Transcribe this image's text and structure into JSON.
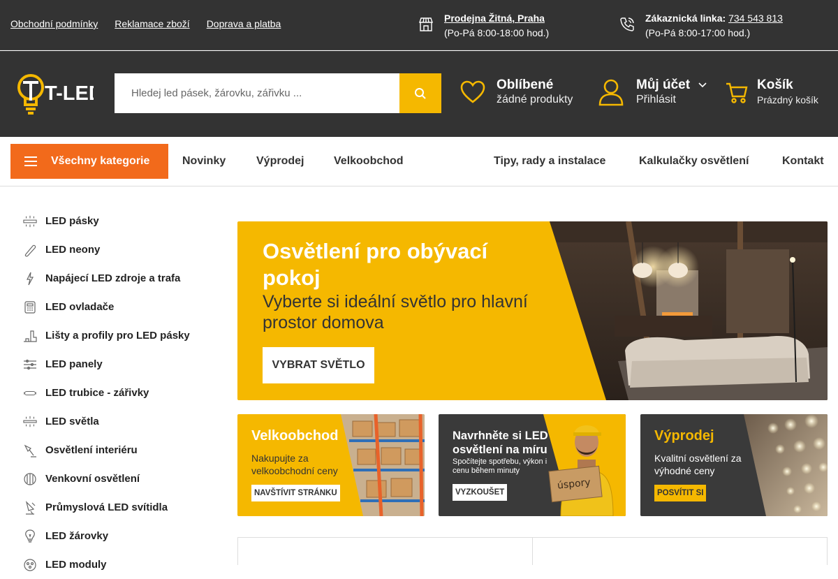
{
  "topbar": {
    "links": [
      "Obchodní podmínky",
      "Reklamace zboží",
      "Doprava a platba"
    ],
    "store_name": "Prodejna Žitná, Praha",
    "store_hours": "(Po-Pá 8:00-18:00 hod.)",
    "phone_label": "Zákaznická linka:",
    "phone_number": "734 543 813",
    "phone_hours": "(Po-Pá 8:00-17:00 hod.)"
  },
  "header": {
    "logo_text": "T-LED",
    "search_placeholder": "Hledej led pásek, žárovku, zářivku ...",
    "favorites_title": "Oblíbené",
    "favorites_sub": "žádné produkty",
    "account_title": "Můj účet",
    "account_sub": "Přihlásit",
    "cart_title": "Košík",
    "cart_sub": "Prázdný košík"
  },
  "nav": {
    "all_categories": "Všechny kategorie",
    "items": [
      "Novinky",
      "Výprodej",
      "Velkoobchod",
      "Tipy, rady a instalace",
      "Kalkulačky osvětlení",
      "Kontakt"
    ]
  },
  "sidebar": {
    "items": [
      {
        "label": "LED pásky",
        "icon": "led-strip-icon"
      },
      {
        "label": "LED neony",
        "icon": "neon-icon"
      },
      {
        "label": "Napájecí LED zdroje a trafa",
        "icon": "power-icon"
      },
      {
        "label": "LED ovladače",
        "icon": "remote-icon"
      },
      {
        "label": "Lišty a profily pro LED pásky",
        "icon": "profile-icon"
      },
      {
        "label": "LED panely",
        "icon": "panel-icon"
      },
      {
        "label": "LED trubice - zářivky",
        "icon": "tube-icon"
      },
      {
        "label": "LED světla",
        "icon": "ceiling-light-icon"
      },
      {
        "label": "Osvětlení interiéru",
        "icon": "lamp-icon"
      },
      {
        "label": "Venkovní osvětlení",
        "icon": "outdoor-icon"
      },
      {
        "label": "Průmyslová LED svítidla",
        "icon": "industrial-icon"
      },
      {
        "label": "LED žárovky",
        "icon": "bulb-icon"
      },
      {
        "label": "LED moduly",
        "icon": "module-icon"
      }
    ]
  },
  "hero": {
    "title": "Osvětlení pro obývací pokoj",
    "subtitle": "Vyberte si ideální světlo pro hlavní prostor domova",
    "button": "VYBRAT SVĚTLO"
  },
  "banners": [
    {
      "title": "Velkoobchod",
      "text": "Nakupujte za velkoobchodní ceny",
      "button": "NAVŠTÍVIT STRÁNKU"
    },
    {
      "title": "Navrhněte si LED osvětlení na míru",
      "text": "Spočítejte spotřebu, výkon i cenu během minuty",
      "button": "VYZKOUŠET",
      "sign": "úspory"
    },
    {
      "title": "Výprodej",
      "text": "Kvalitní osvětlení za výhodné ceny",
      "button": "POSVÍTIT SI"
    }
  ],
  "colors": {
    "accent": "#f5b800",
    "orange": "#f26a1b",
    "dark": "#333333"
  }
}
